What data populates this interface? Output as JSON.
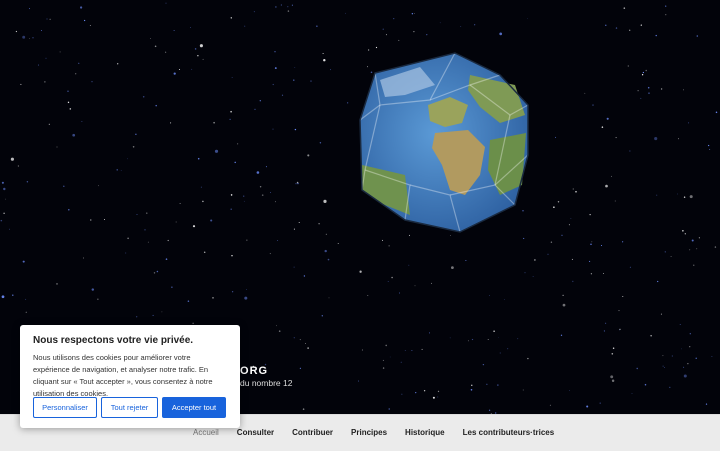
{
  "site": {
    "title": ".ORG",
    "description": "du nombre 12"
  },
  "nav": {
    "items": [
      {
        "label": "Accueil",
        "current": true
      },
      {
        "label": "Consulter"
      },
      {
        "label": "Contribuer"
      },
      {
        "label": "Principes"
      },
      {
        "label": "Historique"
      },
      {
        "label": "Les contributeurs·trices"
      }
    ]
  },
  "cookie_banner": {
    "title": "Nous respectons votre vie privée.",
    "text": "Nous utilisons des cookies pour améliorer votre expérience de navigation, et analyser notre trafic. En cliquant sur « Tout accepter », vous consentez à notre utilisation des cookies.",
    "customize_label": "Personnaliser",
    "reject_label": "Tout rejeter",
    "accept_label": "Accepter tout"
  },
  "colors": {
    "accent": "#1863dc",
    "nav_background": "#ebebeb",
    "hero_background": "#02030a"
  },
  "hero": {
    "image": "dodecahedron-earth-icon"
  }
}
